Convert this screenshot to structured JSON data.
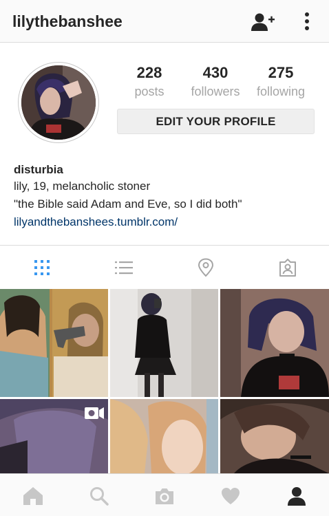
{
  "header": {
    "username": "lilythebanshee",
    "add_user_icon": "add-person-icon",
    "more_icon": "vertical-dots-icon"
  },
  "profile": {
    "stats": [
      {
        "value": "228",
        "label": "posts"
      },
      {
        "value": "430",
        "label": "followers"
      },
      {
        "value": "275",
        "label": "following"
      }
    ],
    "edit_button_label": "EDIT YOUR PROFILE"
  },
  "bio": {
    "name": "disturbia",
    "lines": [
      "lily, 19, melancholic stoner",
      "\"the Bible said Adam and Eve, so I did both\""
    ],
    "link": "lilyandthebanshees.tumblr.com/"
  },
  "tabs": [
    "grid-icon",
    "list-icon",
    "location-pin-icon",
    "tagged-photos-icon"
  ],
  "active_tab": "grid",
  "posts": [
    {
      "type": "photo"
    },
    {
      "type": "photo"
    },
    {
      "type": "photo"
    },
    {
      "type": "video"
    },
    {
      "type": "photo"
    },
    {
      "type": "photo"
    }
  ],
  "bottom_nav": [
    "home-icon",
    "search-icon",
    "camera-icon",
    "heart-icon",
    "profile-icon"
  ],
  "active_nav": "profile",
  "colors": {
    "accent": "#3897f0",
    "link": "#003569",
    "muted": "#a5a5a5",
    "divider": "#dbdbdb"
  }
}
